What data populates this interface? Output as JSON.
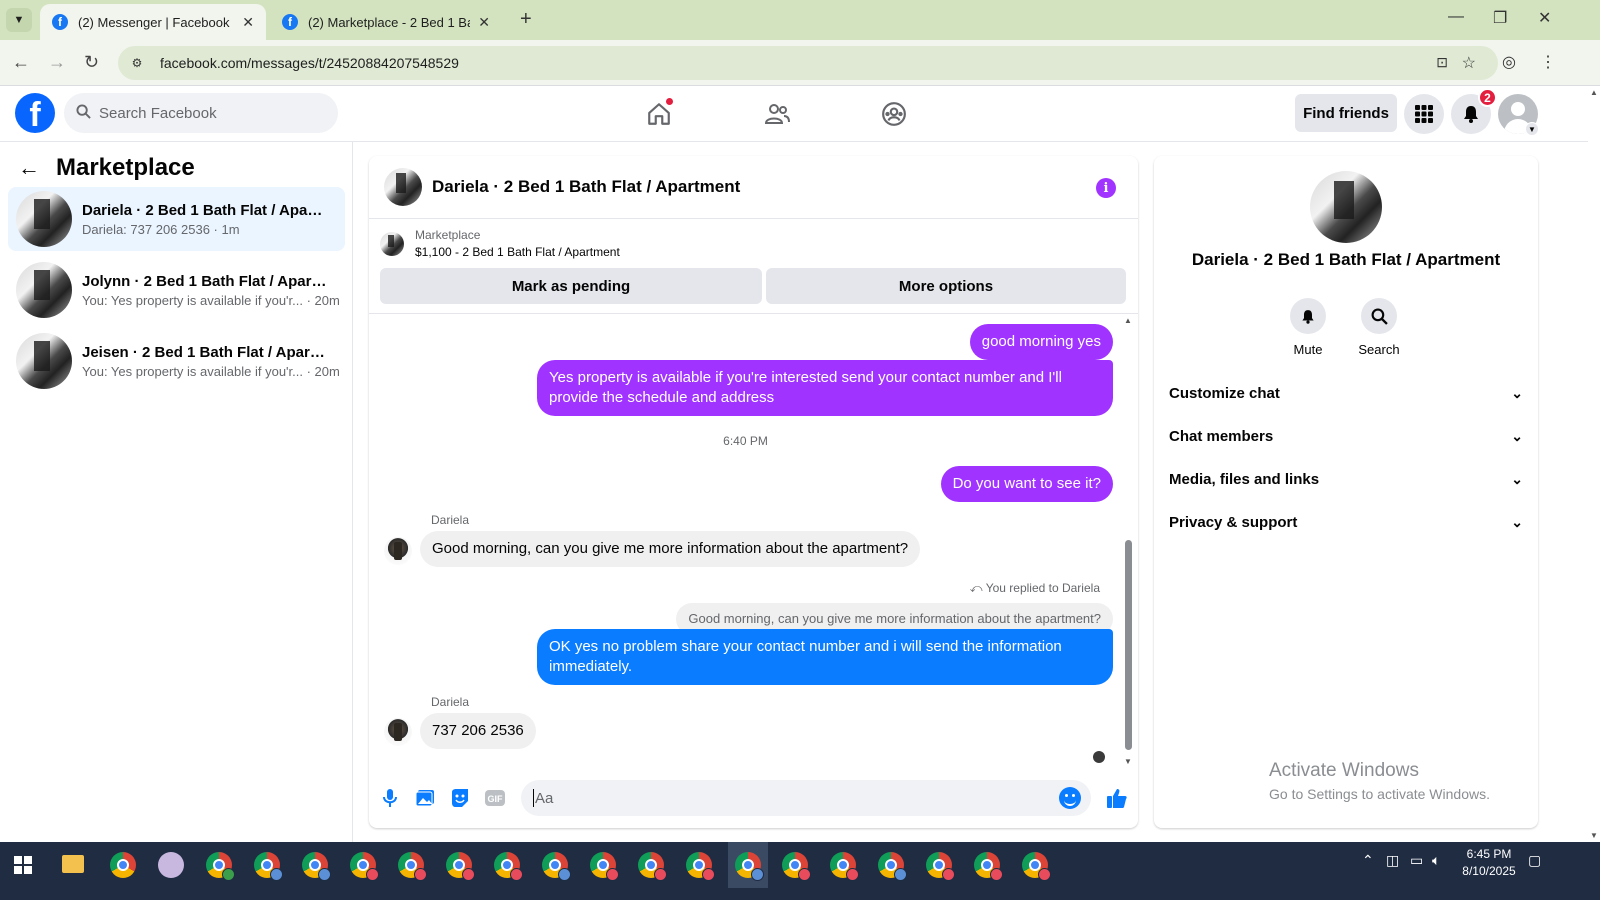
{
  "browser": {
    "tabs": [
      {
        "title": "(2) Messenger | Facebook",
        "active": true
      },
      {
        "title": "(2) Marketplace - 2 Bed 1 Bath F",
        "active": false
      }
    ],
    "url": "facebook.com/messages/t/24520884207548529"
  },
  "fb_header": {
    "search_placeholder": "Search Facebook",
    "find_friends": "Find friends",
    "notification_count": "2"
  },
  "left_panel": {
    "title": "Marketplace",
    "conversations": [
      {
        "name": "Dariela · 2 Bed 1 Bath Flat / Apart...",
        "preview": "Dariela: 737 206 2536 · 1m",
        "selected": true
      },
      {
        "name": "Jolynn · 2 Bed 1 Bath Flat / Apartm...",
        "preview": "You: Yes property is available if you'r... · 20m",
        "selected": false
      },
      {
        "name": "Jeisen · 2 Bed 1 Bath Flat / Apartm...",
        "preview": "You: Yes property is available if you'r... · 20m",
        "selected": false
      }
    ]
  },
  "chat": {
    "title": "Dariela · 2 Bed 1 Bath Flat / Apartment",
    "marketplace_label": "Marketplace",
    "listing": "$1,100 - 2 Bed 1 Bath Flat / Apartment",
    "mark_pending": "Mark as pending",
    "more_options": "More options",
    "messages": {
      "m1": "good morning yes",
      "m2": "Yes property is  available if you're interested send your contact number and I'll provide the schedule and address",
      "time": "6:40 PM",
      "m3": "Do you want to see it?",
      "sender1": "Dariela",
      "m4": "Good morning, can you give me more information about the apartment?",
      "replied_label": "You replied to Dariela",
      "quoted": "Good morning, can you give me more information about the apartment?",
      "m5": "OK yes no problem share your contact number and i will send the information immediately.",
      "sender2": "Dariela",
      "m6": "737 206 2536"
    },
    "composer_placeholder": "Aa"
  },
  "right_panel": {
    "name": "Dariela · 2 Bed 1 Bath Flat / Apartment",
    "mute": "Mute",
    "search": "Search",
    "sections": [
      "Customize chat",
      "Chat members",
      "Media, files and links",
      "Privacy & support"
    ]
  },
  "watermark": {
    "line1": "Activate Windows",
    "line2": "Go to Settings to activate Windows."
  },
  "taskbar": {
    "time": "6:45 PM",
    "date": "8/10/2025"
  },
  "colors": {
    "purple_bubble": "#a033ff",
    "blue_bubble": "#0a7cff",
    "fb_blue": "#0866ff",
    "chrome_frame": "#d3e3c0"
  }
}
